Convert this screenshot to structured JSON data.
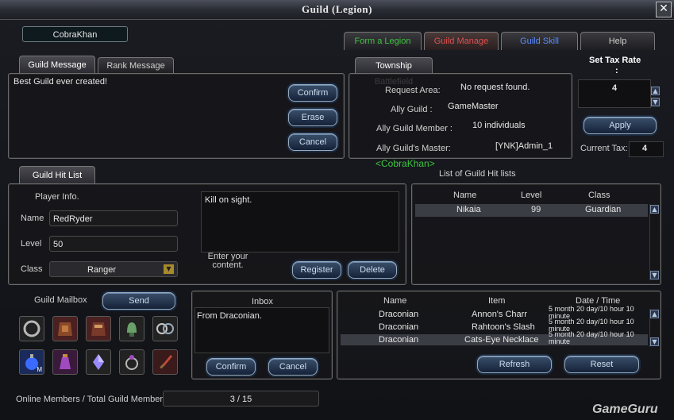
{
  "window": {
    "title": "Guild (Legion)",
    "close_glyph": "✕"
  },
  "player_name": "CobraKhan",
  "top_tabs": [
    "Form a Legion",
    "Guild Manage",
    "Guild Skill",
    "Help"
  ],
  "message_tabs": [
    "Guild Message",
    "Rank Message"
  ],
  "guild_message": {
    "text": "Best Guild ever created!",
    "confirm": "Confirm",
    "erase": "Erase",
    "cancel": "Cancel"
  },
  "township": {
    "tab": "Township Battlefield",
    "request_area_label": "Request Area:",
    "request_area_value": "No request found.",
    "ally_guild_label": "Ally Guild :",
    "ally_guild_value": "GameMaster",
    "ally_member_label": "Ally Guild Member :",
    "ally_member_value": "10 individuals",
    "ally_master_label": "Ally Guild's Master:",
    "ally_master_value": "[YNK]Admin_1"
  },
  "tax": {
    "title": "Set Tax Rate",
    "colon": ":",
    "rate_value": "4",
    "apply": "Apply",
    "current_label": "Current Tax:",
    "current_value": "4"
  },
  "hitlist": {
    "tab": "Guild Hit List",
    "name_tag": "<CobraKhan>",
    "list_title": "List of Guild Hit lists",
    "player_info": "Player Info.",
    "name_label": "Name",
    "name_value": "RedRyder",
    "level_label": "Level",
    "level_value": "50",
    "class_label": "Class",
    "class_value": "Ranger",
    "note": "Kill on sight.",
    "enter_content": "Enter your content.",
    "register": "Register",
    "delete": "Delete",
    "columns": [
      "Name",
      "Level",
      "Class"
    ],
    "rows": [
      {
        "name": "Nikaia",
        "level": "99",
        "class": "Guardian"
      }
    ]
  },
  "mailbox": {
    "label": "Guild Mailbox",
    "send": "Send",
    "items": [
      "ring-icon",
      "leather-armor-icon",
      "plate-armor-icon",
      "helmet-icon",
      "rings-icon",
      "mana-potion-icon",
      "purple-potion-icon",
      "crystal-icon",
      "gem-ring-icon",
      "dagger-icon"
    ],
    "potion_badge": "M"
  },
  "inbox": {
    "title": "Inbox",
    "text": "From Draconian.",
    "confirm": "Confirm",
    "cancel": "Cancel"
  },
  "mail_list": {
    "columns": [
      "Name",
      "Item",
      "Date / Time"
    ],
    "rows": [
      {
        "name": "Draconian",
        "item": "Annon's Charr",
        "date": "5 month 20 day/10 hour 10 minute"
      },
      {
        "name": "Draconian",
        "item": "Rahtoon's Slash",
        "date": "5 month 20 day/10 hour 10 minute"
      },
      {
        "name": "Draconian",
        "item": "Cats-Eye Necklace",
        "date": "5 month 20 day/10 hour 10 minute"
      }
    ],
    "refresh": "Refresh",
    "reset": "Reset"
  },
  "footer": {
    "label": "Online Members / Total Guild Members",
    "value": "3 / 15",
    "watermark": "GameGuru"
  },
  "colors": {
    "accent_green": "#3fc43f",
    "accent_red": "#e05050",
    "accent_blue": "#5a8cff",
    "button_blue": "#142238"
  }
}
